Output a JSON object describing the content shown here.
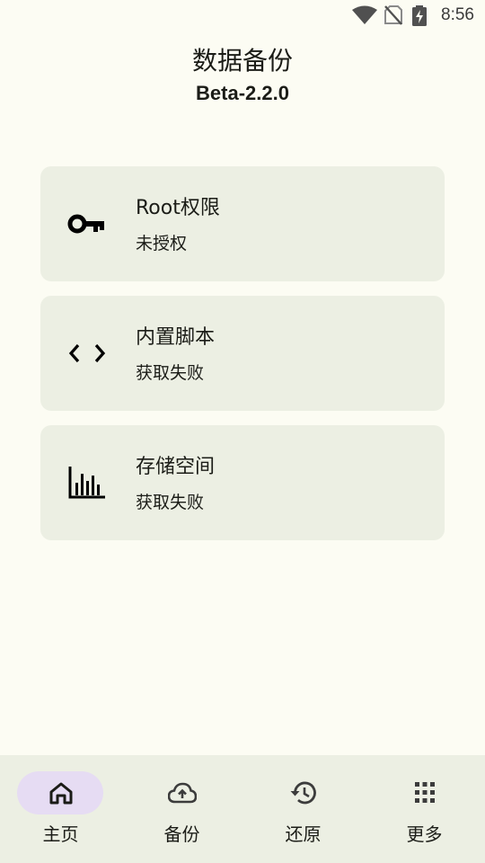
{
  "status_bar": {
    "time": "8:56",
    "icons": [
      "wifi-icon",
      "no-sim-icon",
      "battery-charging-icon"
    ]
  },
  "header": {
    "title": "数据备份",
    "version": "Beta-2.2.0"
  },
  "cards": [
    {
      "icon": "key-icon",
      "title": "Root权限",
      "status": "未授权"
    },
    {
      "icon": "code-icon",
      "title": "内置脚本",
      "status": "获取失败"
    },
    {
      "icon": "bar-chart-icon",
      "title": "存储空间",
      "status": "获取失败"
    }
  ],
  "bottom_nav": {
    "items": [
      {
        "icon": "home-icon",
        "label": "主页",
        "active": true
      },
      {
        "icon": "cloud-upload-icon",
        "label": "备份",
        "active": false
      },
      {
        "icon": "history-icon",
        "label": "还原",
        "active": false
      },
      {
        "icon": "apps-grid-icon",
        "label": "更多",
        "active": false
      }
    ]
  },
  "colors": {
    "background": "#fcfcf3",
    "card": "#ecefe3",
    "nav_active_pill": "#e6dcf3",
    "text": "#1b1c17"
  }
}
